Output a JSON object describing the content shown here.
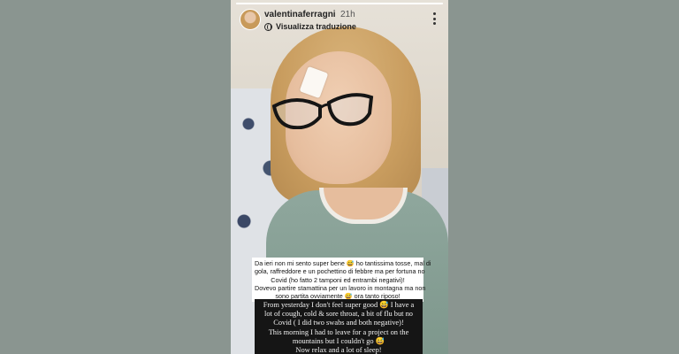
{
  "story": {
    "username": "valentinaferragni",
    "time_ago": "21h",
    "translate_label": "Visualizza traduzione",
    "progress": 1.0,
    "icons": {
      "translate": "globe-icon",
      "options": "more-vertical-icon"
    },
    "caption_italian": [
      "Da ieri non mi sento super bene 😅 ho tantissima tosse, mal di",
      "gola, raffreddore e un pochettino di febbre ma per fortuna no",
      "Covid (ho fatto 2 tamponi ed entrambi negativi)!",
      "Dovevo partire stamattina per un lavoro in montagna ma non",
      "sono partita ovviamente 😅 ora tanto riposo!"
    ],
    "caption_english": [
      "From yesterday I don't feel super good 😅 I have a",
      "lot of cough, cold & sore throat, a bit of flu but no",
      "Covid ( I did two swabs and both negative)!",
      "This morning I had to leave for a project on the",
      "mountains but I couldn't go 😅",
      "Now relax and a lot of sleep!"
    ]
  },
  "colors": {
    "page_background": "#8a9590",
    "caption_italian_bg": "#ffffff",
    "caption_english_bg": "#151515"
  }
}
